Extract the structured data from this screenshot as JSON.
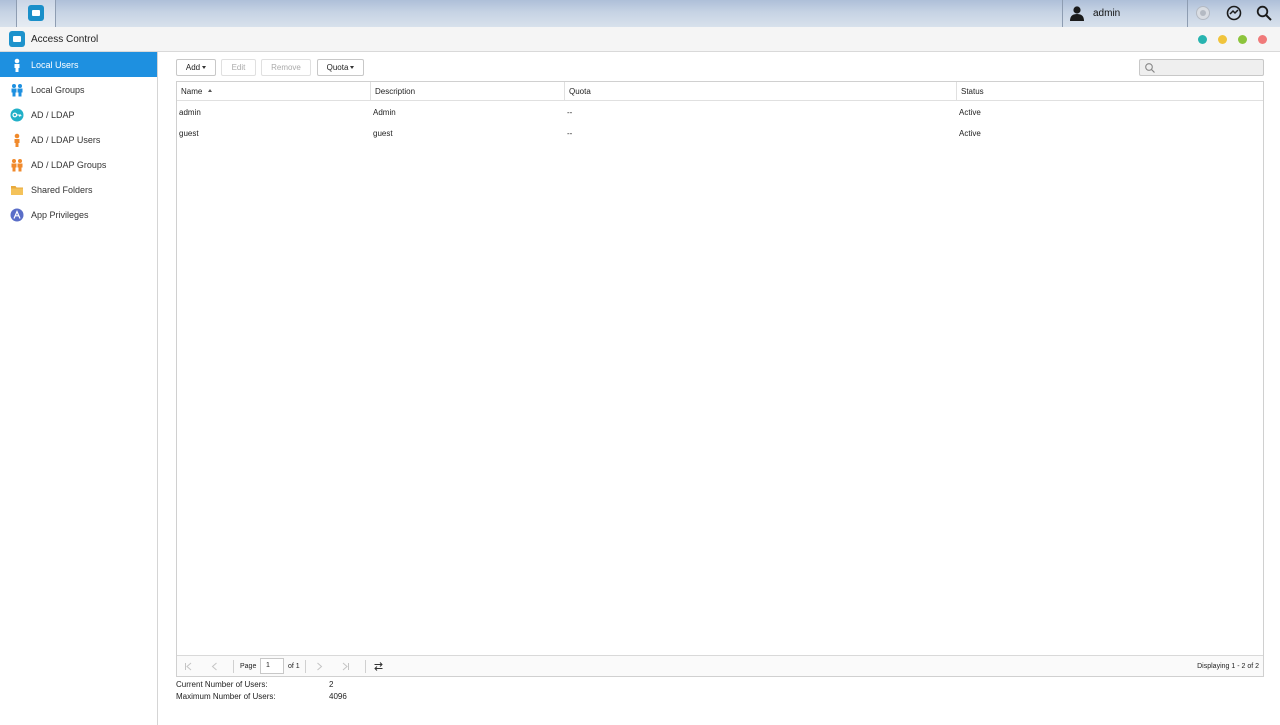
{
  "taskbar": {
    "username": "admin"
  },
  "window": {
    "title": "Access Control"
  },
  "sidebar": {
    "items": [
      {
        "label": "Local Users",
        "icon": "user-icon",
        "active": true
      },
      {
        "label": "Local Groups",
        "icon": "group-icon"
      },
      {
        "label": "AD / LDAP",
        "icon": "key-icon"
      },
      {
        "label": "AD / LDAP Users",
        "icon": "user-icon"
      },
      {
        "label": "AD / LDAP Groups",
        "icon": "group-icon"
      },
      {
        "label": "Shared Folders",
        "icon": "folder-icon"
      },
      {
        "label": "App Privileges",
        "icon": "app-icon"
      }
    ]
  },
  "toolbar": {
    "add_label": "Add",
    "edit_label": "Edit",
    "remove_label": "Remove",
    "quota_label": "Quota"
  },
  "table": {
    "columns": [
      "Name",
      "Description",
      "Quota",
      "Status"
    ],
    "rows": [
      [
        "admin",
        "Admin",
        "--",
        "Active"
      ],
      [
        "guest",
        "guest",
        "--",
        "Active"
      ]
    ]
  },
  "pager": {
    "page_label": "Page",
    "page_value": "1",
    "of_label": "of 1",
    "display_text": "Displaying 1 - 2 of 2"
  },
  "stats": {
    "current_label": "Current Number of Users:",
    "current_value": "2",
    "max_label": "Maximum Number of Users:",
    "max_value": "4096"
  },
  "colors": {
    "accent": "#1e90e0",
    "window_teal": "#28b4b0",
    "window_yellow": "#f0c43c",
    "window_green": "#8cc43c",
    "window_red": "#f07a7a"
  }
}
